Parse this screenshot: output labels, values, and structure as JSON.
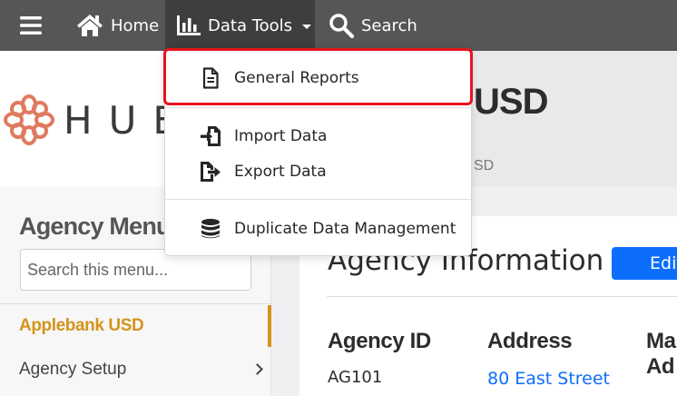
{
  "topnav": {
    "home_label": "Home",
    "datatools_label": "Data Tools",
    "search_label": "Search",
    "icons": [
      "menu-icon",
      "home-icon",
      "bar-chart-icon",
      "chevron-down-icon",
      "search-icon"
    ]
  },
  "dropdown": {
    "items": [
      {
        "label": "General Reports",
        "icon": "file-text-icon"
      },
      {
        "label": "Import Data",
        "icon": "import-icon"
      },
      {
        "label": "Export Data",
        "icon": "export-icon"
      },
      {
        "label": "Duplicate Data Management",
        "icon": "database-icon"
      }
    ],
    "highlight_color": "#e8141c"
  },
  "header": {
    "logo_text": "HUB",
    "banner_title": "USD",
    "banner_subtitle": "SD"
  },
  "sidebar": {
    "heading": "Agency Menu",
    "search_placeholder": "Search this menu...",
    "items": [
      {
        "label": "Applebank USD",
        "active": true
      },
      {
        "label": "Agency Setup",
        "active": false
      }
    ],
    "accent_color": "#d4941c"
  },
  "main": {
    "title": "Agency Information",
    "edit_button": "Edit",
    "columns": [
      "Agency ID",
      "Address",
      "Ma\nAd"
    ],
    "row": {
      "agency_id": "AG101",
      "address": "80 East Street"
    },
    "link_color": "#0d6efd"
  }
}
